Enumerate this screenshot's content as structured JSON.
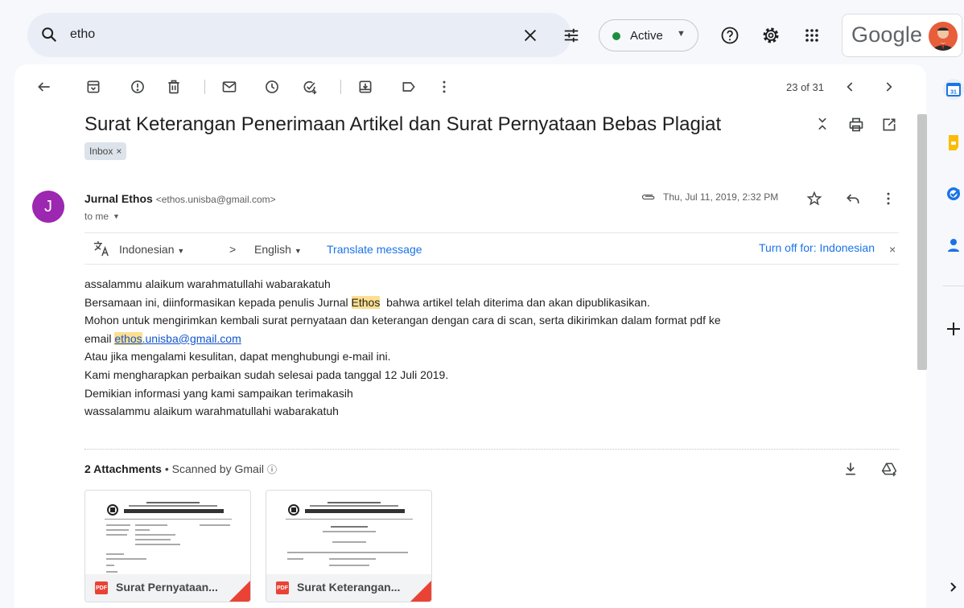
{
  "search": {
    "query": "etho"
  },
  "status": {
    "label": "Active",
    "color": "#1e8e3e"
  },
  "brand": {
    "wordmark": "Google"
  },
  "toolbar": {
    "counter": "23 of 31"
  },
  "email": {
    "subject": "Surat Keterangan Penerimaan Artikel dan Surat Pernyataan Bebas Plagiat",
    "label_chip": "Inbox",
    "avatar_letter": "J",
    "avatar_color": "#9c27b0",
    "sender_name": "Jurnal Ethos",
    "sender_email": "<ethos.unisba@gmail.com>",
    "to": "to me",
    "date": "Thu, Jul 11, 2019, 2:32 PM"
  },
  "translate": {
    "from_lang": "Indonesian",
    "to_lang": "English",
    "translate_link": "Translate message",
    "turn_off": "Turn off for: Indonesian"
  },
  "body": {
    "line1": "assalammu alaikum warahmatullahi wabarakatuh",
    "line2_pre": "Bersamaan ini, diinformasikan kepada penulis Jurnal ",
    "line2_hl": "Ethos",
    "line2_post": "  bahwa artikel telah diterima dan akan dipublikasikan.",
    "line3": "Mohon untuk mengirimkan kembali surat pernyataan dan keterangan dengan cara di scan, serta dikirimkan dalam format pdf ke",
    "line4_pre": "email ",
    "line4_link_hl": "ethos",
    "line4_link_rest": ".unisba@gmail.com",
    "line5": "Atau jika mengalami kesulitan, dapat menghubungi e-mail ini.",
    "line6": "Kami mengharapkan perbaikan sudah selesai pada tanggal 12 Juli 2019.",
    "line7": "Demikian informasi yang kami sampaikan terimakasih",
    "line8": "wassalammu alaikum warahmatullahi wabarakatuh"
  },
  "attachments": {
    "count_label": "2 Attachments",
    "scanned_label": "Scanned by Gmail",
    "items": [
      {
        "name": "Surat Pernyataan...",
        "type": "PDF"
      },
      {
        "name": "Surat Keterangan...",
        "type": "PDF"
      }
    ]
  },
  "side_panel": {
    "calendar_day": "31"
  }
}
